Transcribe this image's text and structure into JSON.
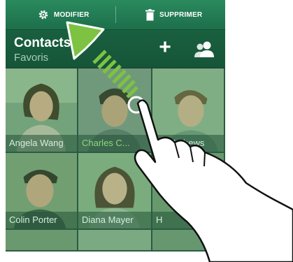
{
  "action_bar": {
    "modify_label": "MODIFIER",
    "delete_label": "SUPPRIMER",
    "modify_icon": "gear-icon",
    "delete_icon": "trash-icon"
  },
  "header": {
    "title": "Contacts",
    "subtitle": "Favoris",
    "add_label": "+",
    "add_icon": "plus-icon",
    "group_icon": "people-icon"
  },
  "contacts": [
    {
      "name": "Angela Wang"
    },
    {
      "name": "Charles C..."
    },
    {
      "name": "ris Mathews"
    },
    {
      "name": "Colin Porter"
    },
    {
      "name": "Diana Mayer"
    },
    {
      "name": "H"
    }
  ],
  "colors": {
    "accent": "#1c6f4a",
    "highlight_text": "#9fe07a",
    "arrow": "#7dc242"
  }
}
